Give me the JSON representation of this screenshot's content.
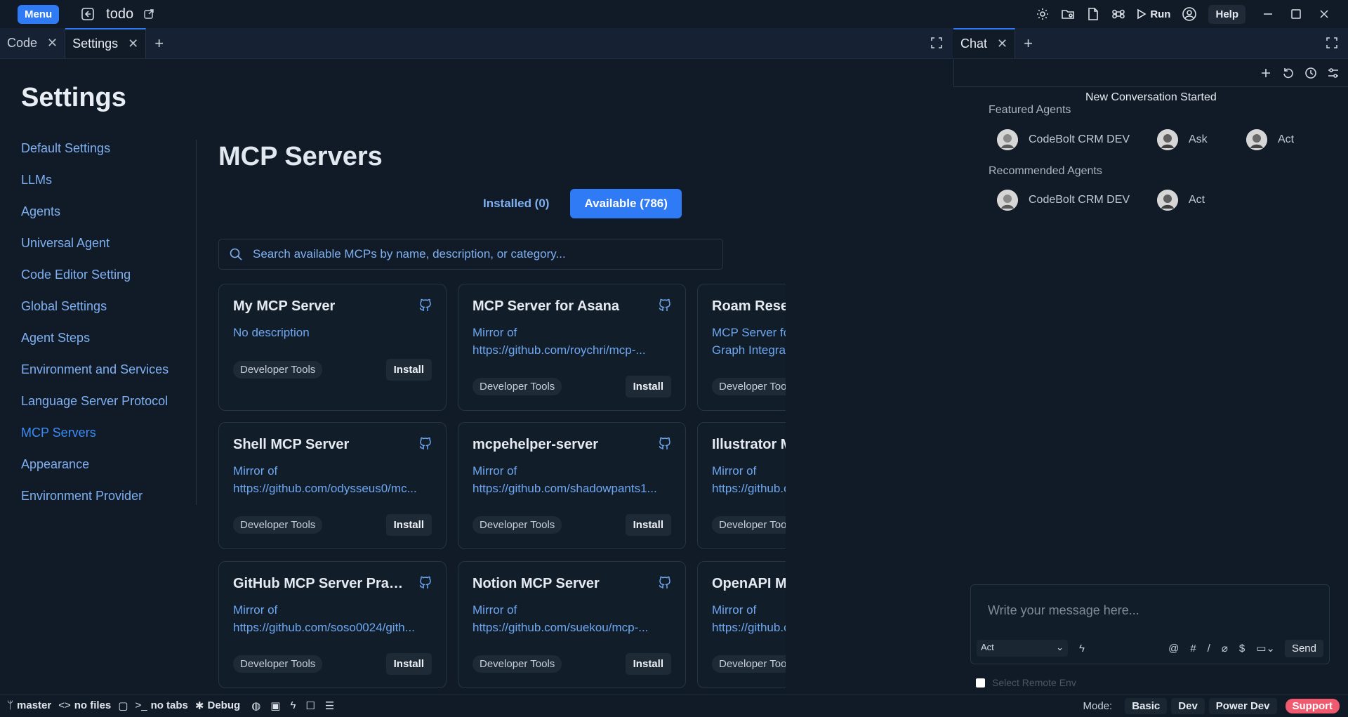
{
  "topbar": {
    "menu_label": "Menu",
    "project_name": "todo",
    "run_label": "Run",
    "help_label": "Help"
  },
  "tabs": [
    {
      "label": "Code",
      "active": false
    },
    {
      "label": "Settings",
      "active": true
    }
  ],
  "chat_tab": {
    "label": "Chat"
  },
  "settings": {
    "title": "Settings",
    "nav": [
      {
        "label": "Default Settings"
      },
      {
        "label": "LLMs"
      },
      {
        "label": "Agents"
      },
      {
        "label": "Universal Agent"
      },
      {
        "label": "Code Editor Setting"
      },
      {
        "label": "Global Settings"
      },
      {
        "label": "Agent Steps"
      },
      {
        "label": "Environment and Services"
      },
      {
        "label": "Language Server Protocol"
      },
      {
        "label": "MCP Servers",
        "active": true
      },
      {
        "label": "Appearance"
      },
      {
        "label": "Environment Provider"
      }
    ]
  },
  "mcp": {
    "title": "MCP Servers",
    "tab_installed": "Installed (0)",
    "tab_available": "Available (786)",
    "search_placeholder": "Search available MCPs by name, description, or category...",
    "install_label": "Install",
    "cards": [
      {
        "title": "My MCP Server",
        "desc": [
          "No description"
        ],
        "tag": "Developer Tools"
      },
      {
        "title": "MCP Server for Asana",
        "desc": [
          "Mirror of",
          "https://github.com/roychri/mcp-..."
        ],
        "tag": "Developer Tools"
      },
      {
        "title": "Roam Research MCP Server",
        "desc": [
          "MCP Server for Roam Research",
          "Graph Integration"
        ],
        "tag": "Developer Tools"
      },
      {
        "title": "Shell MCP Server",
        "desc": [
          "Mirror of",
          "https://github.com/odysseus0/mc..."
        ],
        "tag": "Developer Tools"
      },
      {
        "title": "mcpehelper-server",
        "desc": [
          "Mirror of",
          "https://github.com/shadowpants1..."
        ],
        "tag": "Developer Tools"
      },
      {
        "title": "Illustrator MCP Server",
        "desc": [
          "Mirror of",
          "https://github.com/spencerhhuber..."
        ],
        "tag": "Developer Tools"
      },
      {
        "title": "GitHub MCP Server Practi...",
        "desc": [
          "Mirror of",
          "https://github.com/soso0024/gith..."
        ],
        "tag": "Developer Tools"
      },
      {
        "title": "Notion MCP Server",
        "desc": [
          "Mirror of",
          "https://github.com/suekou/mcp-..."
        ],
        "tag": "Developer Tools"
      },
      {
        "title": "OpenAPI MCP Server",
        "desc": [
          "Mirror of",
          "https://github.com/snaggle-..."
        ],
        "tag": "Developer Tools"
      }
    ]
  },
  "chat": {
    "conversation_status": "New Conversation Started",
    "featured_label": "Featured Agents",
    "recommended_label": "Recommended Agents",
    "featured": [
      "CodeBolt CRM DEV",
      "Ask",
      "Act"
    ],
    "recommended": [
      "CodeBolt CRM DEV",
      "Act"
    ],
    "message_placeholder": "Write your message here...",
    "mode_value": "Act",
    "send_label": "Send",
    "remote_env_label": "Select Remote Env"
  },
  "status": {
    "branch": "master",
    "files": "no files",
    "tabs": "no tabs",
    "debug": "Debug",
    "mode_label": "Mode:",
    "modes": [
      "Basic",
      "Dev",
      "Power Dev"
    ],
    "support": "Support"
  }
}
